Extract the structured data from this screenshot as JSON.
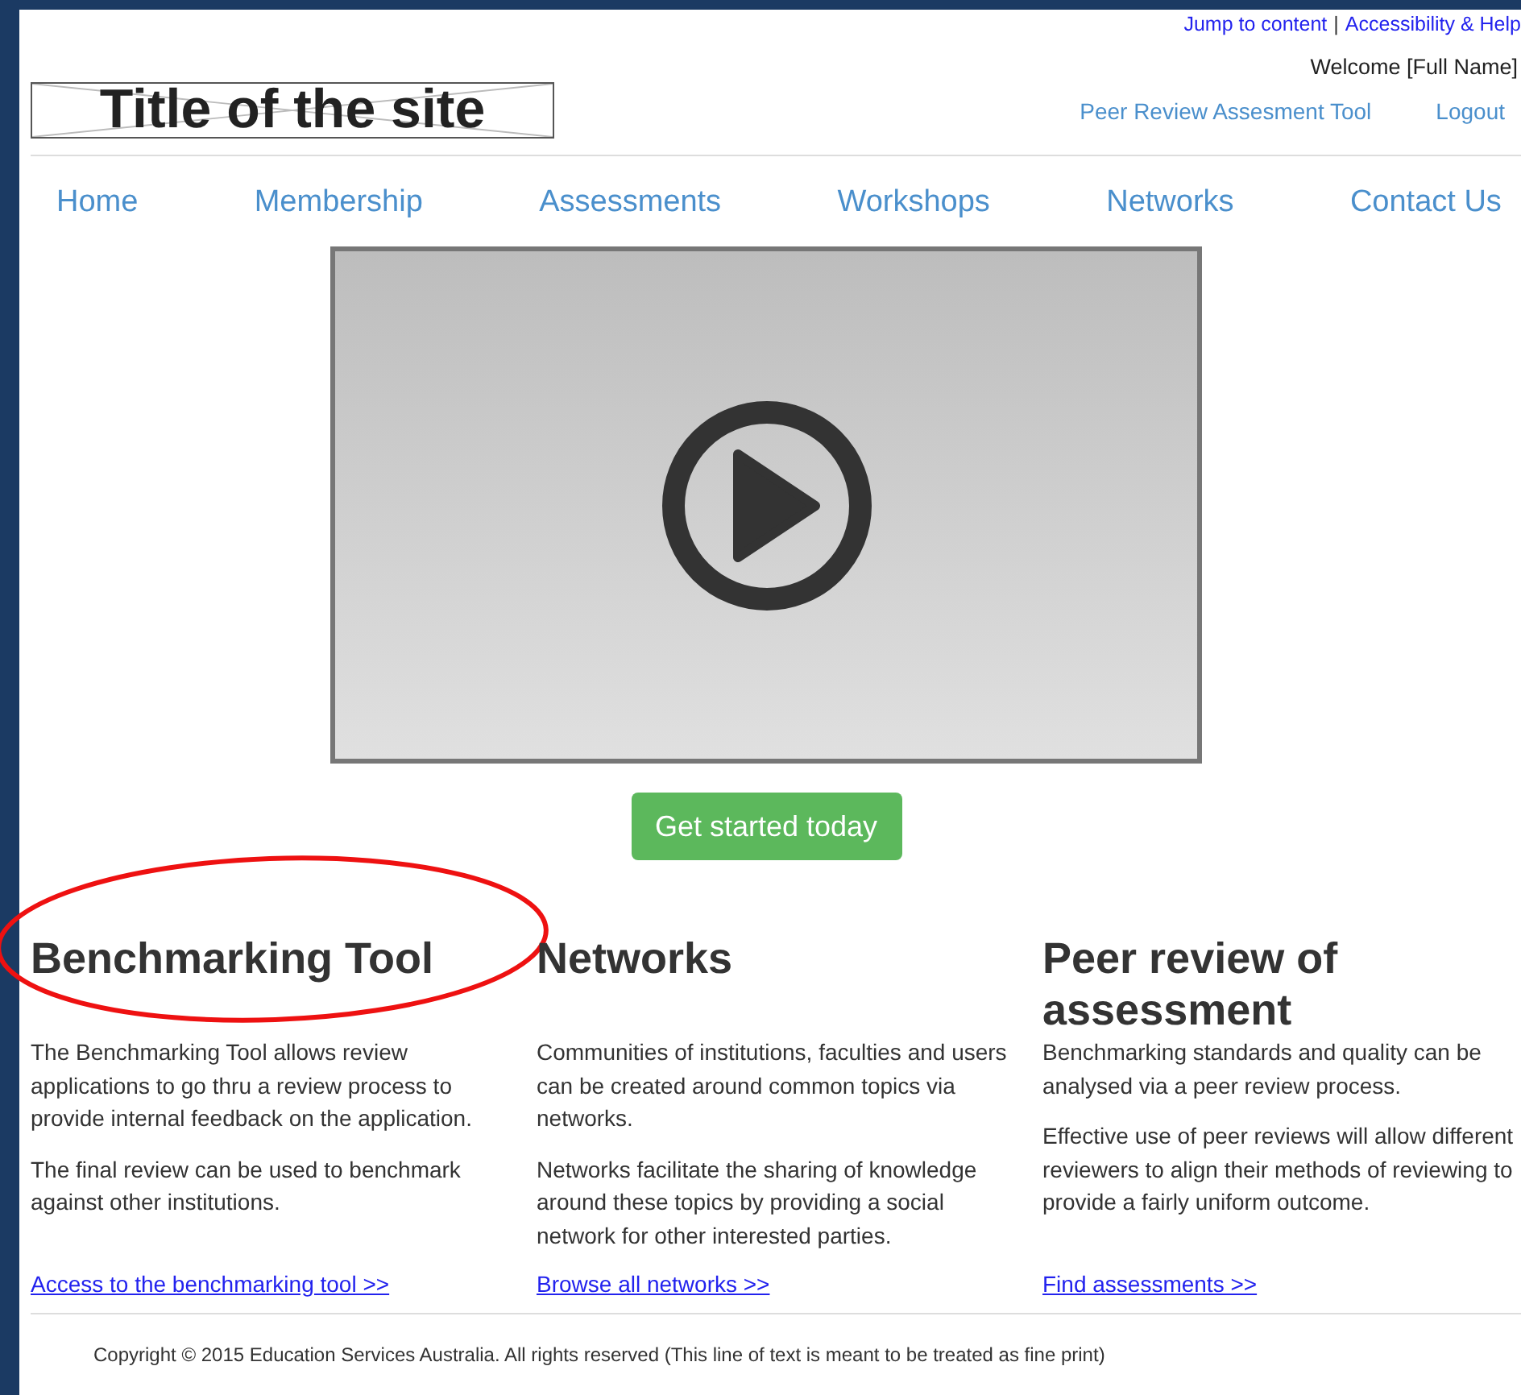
{
  "top_links": [
    "Jump to content",
    "Accessibility & Help"
  ],
  "top_link_separator": "|",
  "welcome": "Welcome [Full Name]",
  "site_title": "Title of the site",
  "user_links": [
    "Peer Review Assesment Tool",
    "Logout"
  ],
  "nav": [
    "Home",
    "Membership",
    "Assessments",
    "Workshops",
    "Networks",
    "Contact Us"
  ],
  "video": {
    "kind": "picture"
  },
  "cta_button": "Get started today",
  "columns": [
    {
      "title": "Benchmarking Tool",
      "paragraphs": [
        "The Benchmarking Tool allows review applications to go thru a review process to provide internal feedback on the application.",
        "The final review can be used to benchmark against other institutions."
      ],
      "link": "Access to the benchmarking tool >>",
      "annotated": true
    },
    {
      "title": "Networks",
      "paragraphs": [
        "Communities of institutions, faculties and users can be created around common topics via networks.",
        "Networks facilitate the sharing of knowledge around these topics by providing a social network for other interested parties."
      ],
      "link": "Browse all networks >>",
      "annotated": false
    },
    {
      "title": "Peer review of assessment",
      "paragraphs": [
        "Benchmarking standards and quality can be analysed via a peer review process.",
        "Effective use of peer reviews will allow different reviewers to align their methods of reviewing to provide a fairly uniform outcome."
      ],
      "link": "Find assessments >>",
      "annotated": false
    }
  ],
  "copyright": "Copyright © 2015 Education Services Australia. All rights reserved (This line of text is meant to be treated as fine print)"
}
